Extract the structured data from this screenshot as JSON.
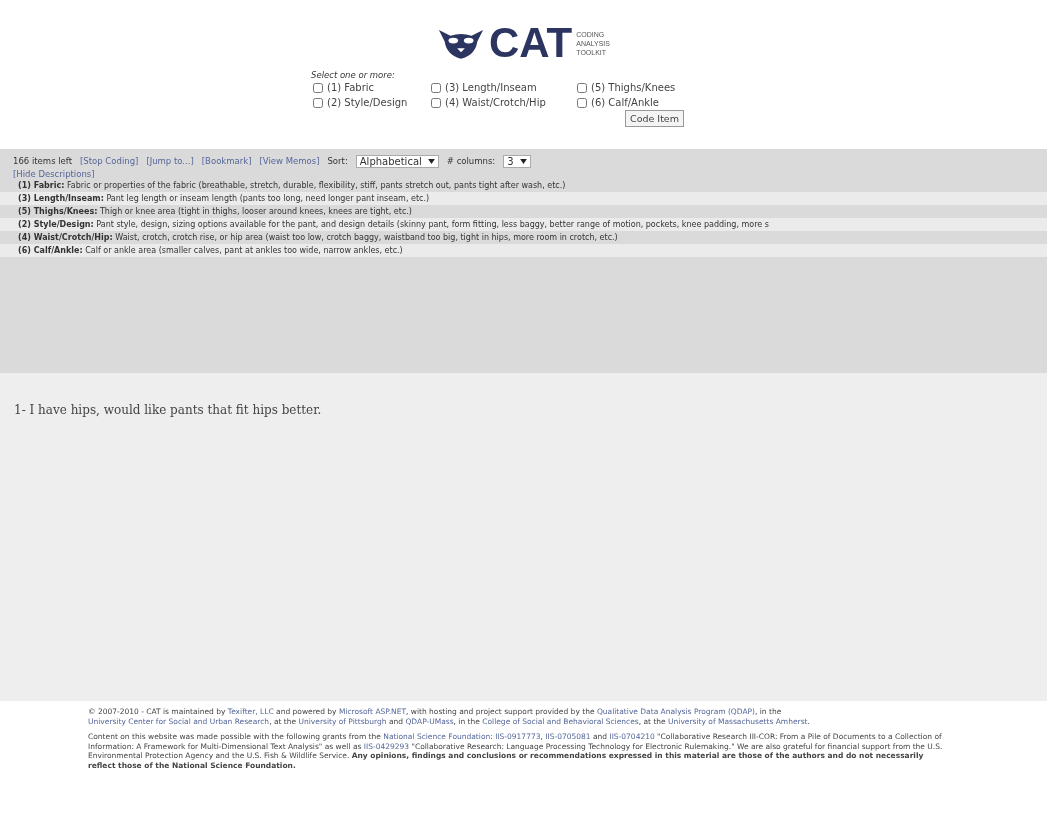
{
  "logo": {
    "name": "CAT",
    "tagline": [
      "CODING",
      "ANALYSIS",
      "TOOLKIT"
    ]
  },
  "codes": {
    "prompt": "Select one or more:",
    "options": [
      {
        "label": "(1) Fabric",
        "checked": false
      },
      {
        "label": "(3) Length/Inseam",
        "checked": false
      },
      {
        "label": "(5) Thighs/Knees",
        "checked": false
      },
      {
        "label": "(2) Style/Design",
        "checked": false
      },
      {
        "label": "(4) Waist/Crotch/Hip",
        "checked": false
      },
      {
        "label": "(6) Calf/Ankle",
        "checked": false
      }
    ],
    "button": "Code Item"
  },
  "toolbar": {
    "count": "166 items left",
    "links": [
      "[Stop Coding]",
      "[Jump to...]",
      "[Bookmark]",
      "[View Memos]"
    ],
    "sort_label": "Sort:",
    "sort_value": "Alphabetical",
    "columns_label": "# columns:",
    "columns_value": "3",
    "hide_link": "[Hide Descriptions]"
  },
  "descriptions": [
    {
      "name": "(1) Fabric:",
      "text": "Fabric or properties of the fabric (breathable, stretch, durable, flexibility, stiff, pants stretch out, pants tight after wash, etc.)"
    },
    {
      "name": "(3) Length/Inseam:",
      "text": "Pant leg length or inseam length (pants too long, need longer pant inseam, etc.)"
    },
    {
      "name": "(5) Thighs/Knees:",
      "text": "Thigh or knee area (tight in thighs, looser around knees, knees are tight, etc.)"
    },
    {
      "name": "(2) Style/Design:",
      "text": "Pant style, design, sizing options available for the pant, and design details (skinny pant, form fitting, less baggy, better range of motion, pockets, knee padding, more s"
    },
    {
      "name": "(4) Waist/Crotch/Hip:",
      "text": "Waist, crotch, crotch rise, or hip area (waist too low, crotch baggy, waistband too big, tight in hips, more room in crotch, etc.)"
    },
    {
      "name": "(6) Calf/Ankle:",
      "text": "Calf or ankle area (smaller calves, pant at ankles too wide, narrow ankles, etc.)"
    }
  ],
  "item": "1- I have hips, would like pants that fit hips better.",
  "footer": [
    [
      {
        "kind": "plain",
        "text": "© 2007-2010 - CAT is maintained by "
      },
      {
        "kind": "link",
        "text": "Texifter, LLC"
      },
      {
        "kind": "plain",
        "text": " and powered by "
      },
      {
        "kind": "link",
        "text": "Microsoft ASP.NET"
      },
      {
        "kind": "plain",
        "text": ", with hosting and project support provided by the "
      },
      {
        "kind": "link",
        "text": "Qualitative Data Analysis Program (QDAP)"
      },
      {
        "kind": "plain",
        "text": ", in the "
      },
      {
        "kind": "link",
        "text": "University Center for Social and Urban Research"
      },
      {
        "kind": "plain",
        "text": ", at the "
      },
      {
        "kind": "link",
        "text": "University of Pittsburgh"
      },
      {
        "kind": "plain",
        "text": " and "
      },
      {
        "kind": "link",
        "text": "QDAP-UMass"
      },
      {
        "kind": "plain",
        "text": ", in the "
      },
      {
        "kind": "link",
        "text": "College of Social and Behavioral Sciences"
      },
      {
        "kind": "plain",
        "text": ", at the "
      },
      {
        "kind": "link",
        "text": "University of Massachusetts Amherst"
      },
      {
        "kind": "plain",
        "text": "."
      }
    ],
    [
      {
        "kind": "plain",
        "text": "Content on this website was made possible with the following grants from the "
      },
      {
        "kind": "link",
        "text": "National Science Foundation"
      },
      {
        "kind": "plain",
        "text": ": "
      },
      {
        "kind": "link",
        "text": "IIS-0917773"
      },
      {
        "kind": "plain",
        "text": ", "
      },
      {
        "kind": "link",
        "text": "IIS-0705081"
      },
      {
        "kind": "plain",
        "text": " and "
      },
      {
        "kind": "link",
        "text": "IIS-0704210"
      },
      {
        "kind": "plain",
        "text": " \"Collaborative Research III-COR: From a Pile of Documents to a Collection of Information: A Framework for Multi-Dimensional Text Analysis\" as well as "
      },
      {
        "kind": "link",
        "text": "IIS-0429293"
      },
      {
        "kind": "plain",
        "text": " \"Collaborative Research: Language Processing Technology for Electronic Rulemaking.\" We are also grateful for financial support from the U.S. Environmental Protection Agency and the U.S. Fish & Wildlife Service. "
      },
      {
        "kind": "bold",
        "text": "Any opinions, findings and conclusions or recommendations expressed in this material are those of the authors and do not necessarily reflect those of the National Science Foundation."
      }
    ]
  ]
}
